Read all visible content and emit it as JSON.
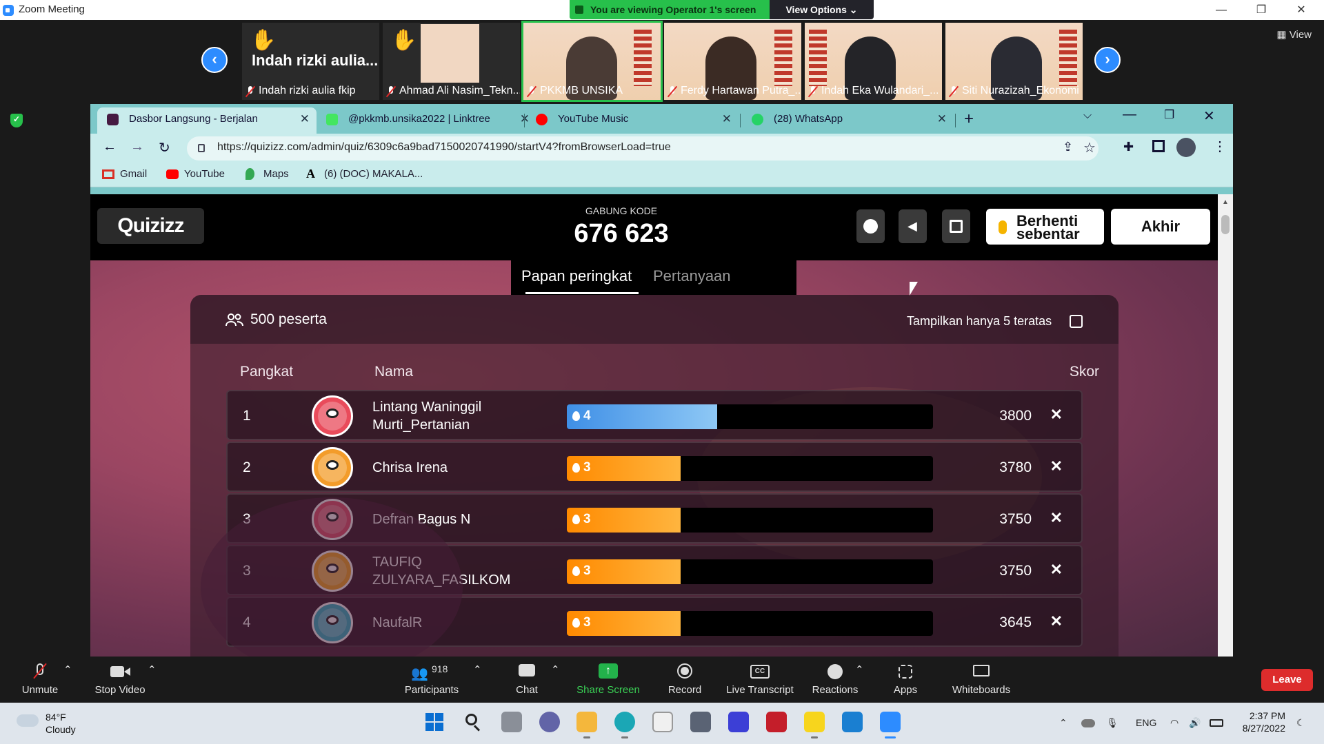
{
  "zoom": {
    "window_title": "Zoom Meeting",
    "viewing_banner": "You are viewing Operator 1's screen",
    "view_options": "View Options ⌄",
    "view_button": "View",
    "participants": [
      {
        "name": "Indah rizki aulia fkip",
        "big_name": "Indah rizki aulia...",
        "hand_raised": true
      },
      {
        "name": "Ahmad Ali Nasim_Tekn...",
        "hand_raised": true
      },
      {
        "name": "PKKMB UNSIKA",
        "active_speaker": true
      },
      {
        "name": "Ferdy Hartawan Putra_..."
      },
      {
        "name": "Indah Eka Wulandari_..."
      },
      {
        "name": "Siti Nurazizah_Ekonomi"
      }
    ],
    "controls": {
      "unmute": "Unmute",
      "stop_video": "Stop Video",
      "participants": "Participants",
      "participant_count": "918",
      "chat": "Chat",
      "share_screen": "Share Screen",
      "record": "Record",
      "live_transcript": "Live Transcript",
      "reactions": "Reactions",
      "apps": "Apps",
      "whiteboards": "Whiteboards",
      "leave": "Leave"
    }
  },
  "browser": {
    "tabs": [
      {
        "title": "Dasbor Langsung - Berjalan",
        "active": true,
        "favicon_color": "#461a42"
      },
      {
        "title": "@pkkmb.unsika2022 | Linktree",
        "favicon_color": "#43e660"
      },
      {
        "title": "YouTube Music",
        "favicon_color": "#ff0000"
      },
      {
        "title": "(28) WhatsApp",
        "favicon_color": "#25d366"
      }
    ],
    "url": "https://quizizz.com/admin/quiz/6309c6a9bad7150020741990/startV4?fromBrowserLoad=true",
    "bookmarks": [
      {
        "label": "Gmail",
        "icon": "gmail-icon"
      },
      {
        "label": "YouTube",
        "icon": "youtube-icon"
      },
      {
        "label": "Maps",
        "icon": "maps-icon"
      },
      {
        "label": "(6) (DOC) MAKALA...",
        "icon": "academia-icon"
      }
    ]
  },
  "quiz": {
    "logo": "Quizizz",
    "join_label": "GABUNG KODE",
    "join_code": "676 623",
    "pause_label_line1": "Berhenti",
    "pause_label_line2": "sebentar",
    "end_label": "Akhir",
    "tab_leaderboard": "Papan peringkat",
    "tab_questions": "Pertanyaan",
    "participant_count": "500 peserta",
    "top5_label": "Tampilkan hanya 5 teratas",
    "col_rank": "Pangkat",
    "col_name": "Nama",
    "col_score": "Skor",
    "rows": [
      {
        "rank": "1",
        "name": "Lintang Waninggil Murti_Pertanian",
        "streak": "4",
        "bar_fraction": 0.41,
        "bar_color": "blue",
        "score": "3800",
        "avatar_color": "#e94b5b"
      },
      {
        "rank": "2",
        "name": "Chrisa Irena",
        "streak": "3",
        "bar_fraction": 0.31,
        "bar_color": "orange",
        "score": "3780",
        "avatar_color": "#f39c2a"
      },
      {
        "rank": "3",
        "name": "Defran Bagus N",
        "streak": "3",
        "bar_fraction": 0.31,
        "bar_color": "orange",
        "score": "3750",
        "avatar_color": "#e5506d"
      },
      {
        "rank": "3",
        "name": "TAUFIQ ZULYARA_FASILKOM",
        "streak": "3",
        "bar_fraction": 0.31,
        "bar_color": "orange",
        "score": "3750",
        "avatar_color": "#f5a623"
      },
      {
        "rank": "4",
        "name": "NaufalR",
        "streak": "3",
        "bar_fraction": 0.31,
        "bar_color": "orange",
        "score": "3645",
        "avatar_color": "#33b5c8"
      }
    ]
  },
  "taskbar": {
    "temperature": "84°F",
    "weather": "Cloudy",
    "language": "ENG",
    "time": "2:37 PM",
    "date": "8/27/2022"
  }
}
